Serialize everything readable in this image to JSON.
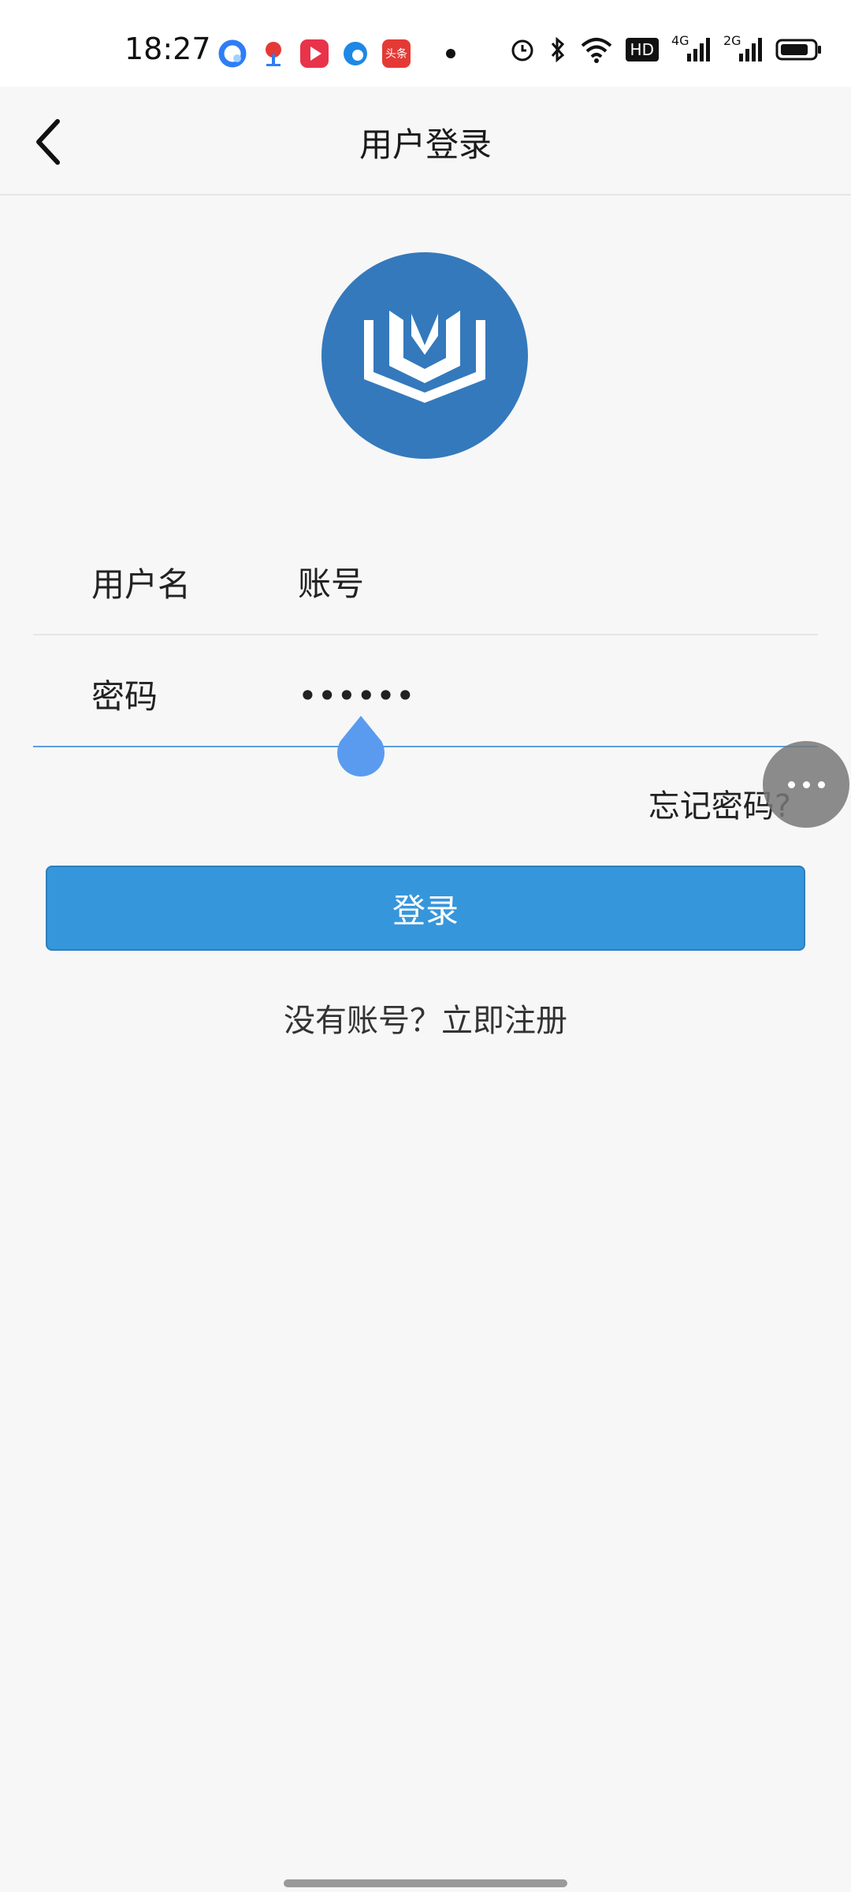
{
  "status_bar": {
    "time": "18:27",
    "apps": [
      {
        "icon": "quark-browser-icon",
        "color": "#2f7df6"
      },
      {
        "icon": "map-pin-icon",
        "color": "#e53935"
      },
      {
        "icon": "video-play-icon",
        "color": "#e8334a"
      },
      {
        "icon": "edge-browser-icon",
        "color": "#1e88e5"
      },
      {
        "icon": "toutiao-icon",
        "color": "#e53935",
        "label": "头条"
      }
    ],
    "system": {
      "hd_label": "HD",
      "net1": "4G",
      "net2": "2G"
    }
  },
  "nav": {
    "title": "用户登录"
  },
  "form": {
    "username": {
      "label": "用户名",
      "placeholder": "账号"
    },
    "password": {
      "label": "密码",
      "value": "••••••"
    },
    "forgot": "忘记密码?",
    "login_button": "登录",
    "register": "没有账号？立即注册"
  },
  "colors": {
    "accent": "#3696db",
    "logo_bg": "#3479bc"
  }
}
